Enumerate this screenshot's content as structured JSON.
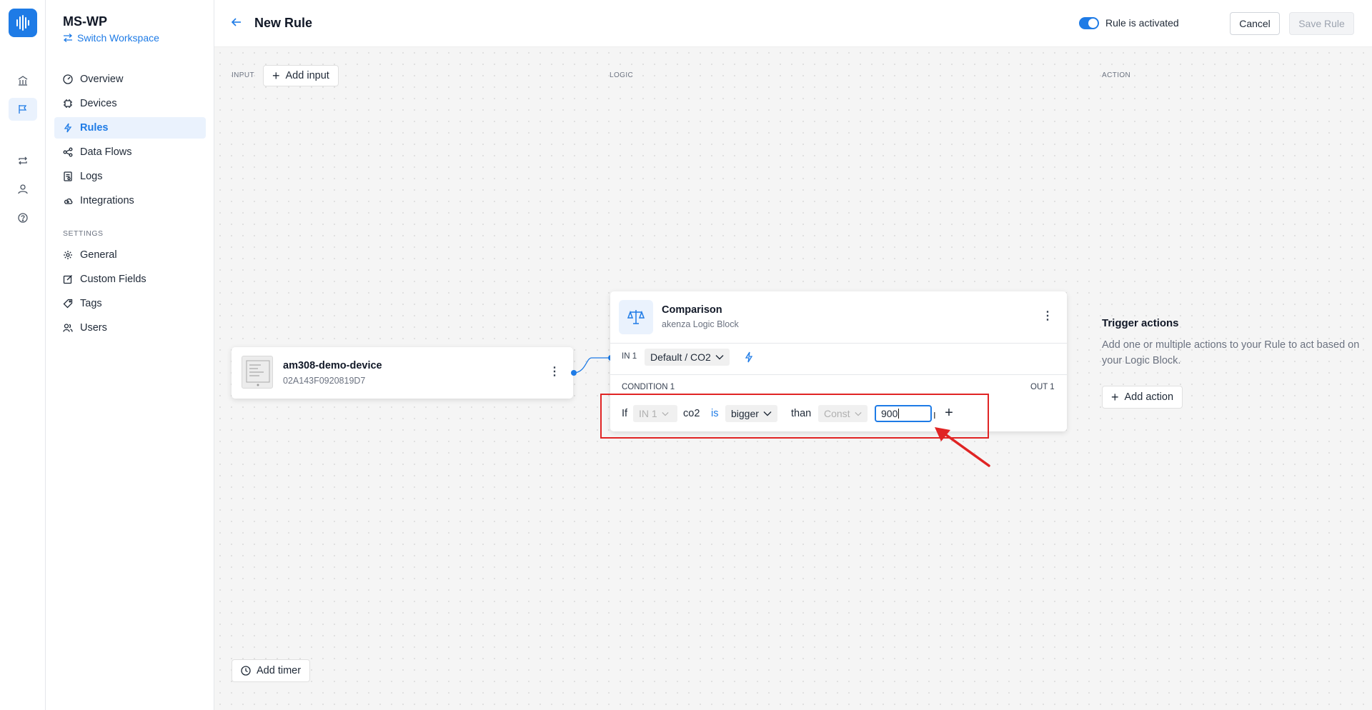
{
  "workspace": {
    "name": "MS-WP",
    "switch_label": "Switch Workspace"
  },
  "nav": {
    "items": [
      {
        "label": "Overview",
        "icon": "gauge-icon"
      },
      {
        "label": "Devices",
        "icon": "chip-icon"
      },
      {
        "label": "Rules",
        "icon": "bolt-icon",
        "active": true
      },
      {
        "label": "Data Flows",
        "icon": "share-icon"
      },
      {
        "label": "Logs",
        "icon": "log-icon"
      },
      {
        "label": "Integrations",
        "icon": "cloud-icon"
      }
    ],
    "settings_heading": "SETTINGS",
    "settings_items": [
      {
        "label": "General",
        "icon": "gear-icon"
      },
      {
        "label": "Custom Fields",
        "icon": "edit-icon"
      },
      {
        "label": "Tags",
        "icon": "tag-icon"
      },
      {
        "label": "Users",
        "icon": "users-icon"
      }
    ]
  },
  "header": {
    "title": "New Rule",
    "toggle_label": "Rule is activated",
    "toggle_on": true,
    "cancel_label": "Cancel",
    "save_label": "Save Rule"
  },
  "canvas": {
    "input_label": "INPUT",
    "logic_label": "LOGIC",
    "action_label": "ACTION",
    "add_input_label": "Add input",
    "add_timer_label": "Add timer"
  },
  "device": {
    "name": "am308-demo-device",
    "id": "02A143F0920819D7"
  },
  "logic_block": {
    "title": "Comparison",
    "subtitle": "akenza Logic Block",
    "in_label": "IN 1",
    "in_source": "Default / CO2",
    "condition_label": "CONDITION 1",
    "out_label": "OUT 1",
    "condition": {
      "if_word": "If",
      "input_select": "IN 1",
      "field": "co2",
      "is_word": "is",
      "operator": "bigger",
      "than_word": "than",
      "value_type": "Const",
      "value": "900"
    }
  },
  "action": {
    "title": "Trigger actions",
    "description": "Add one or multiple actions to your Rule to act based on your Logic Block.",
    "add_action_label": "Add action"
  },
  "colors": {
    "accent": "#1e7be6",
    "highlight": "#e02424"
  }
}
